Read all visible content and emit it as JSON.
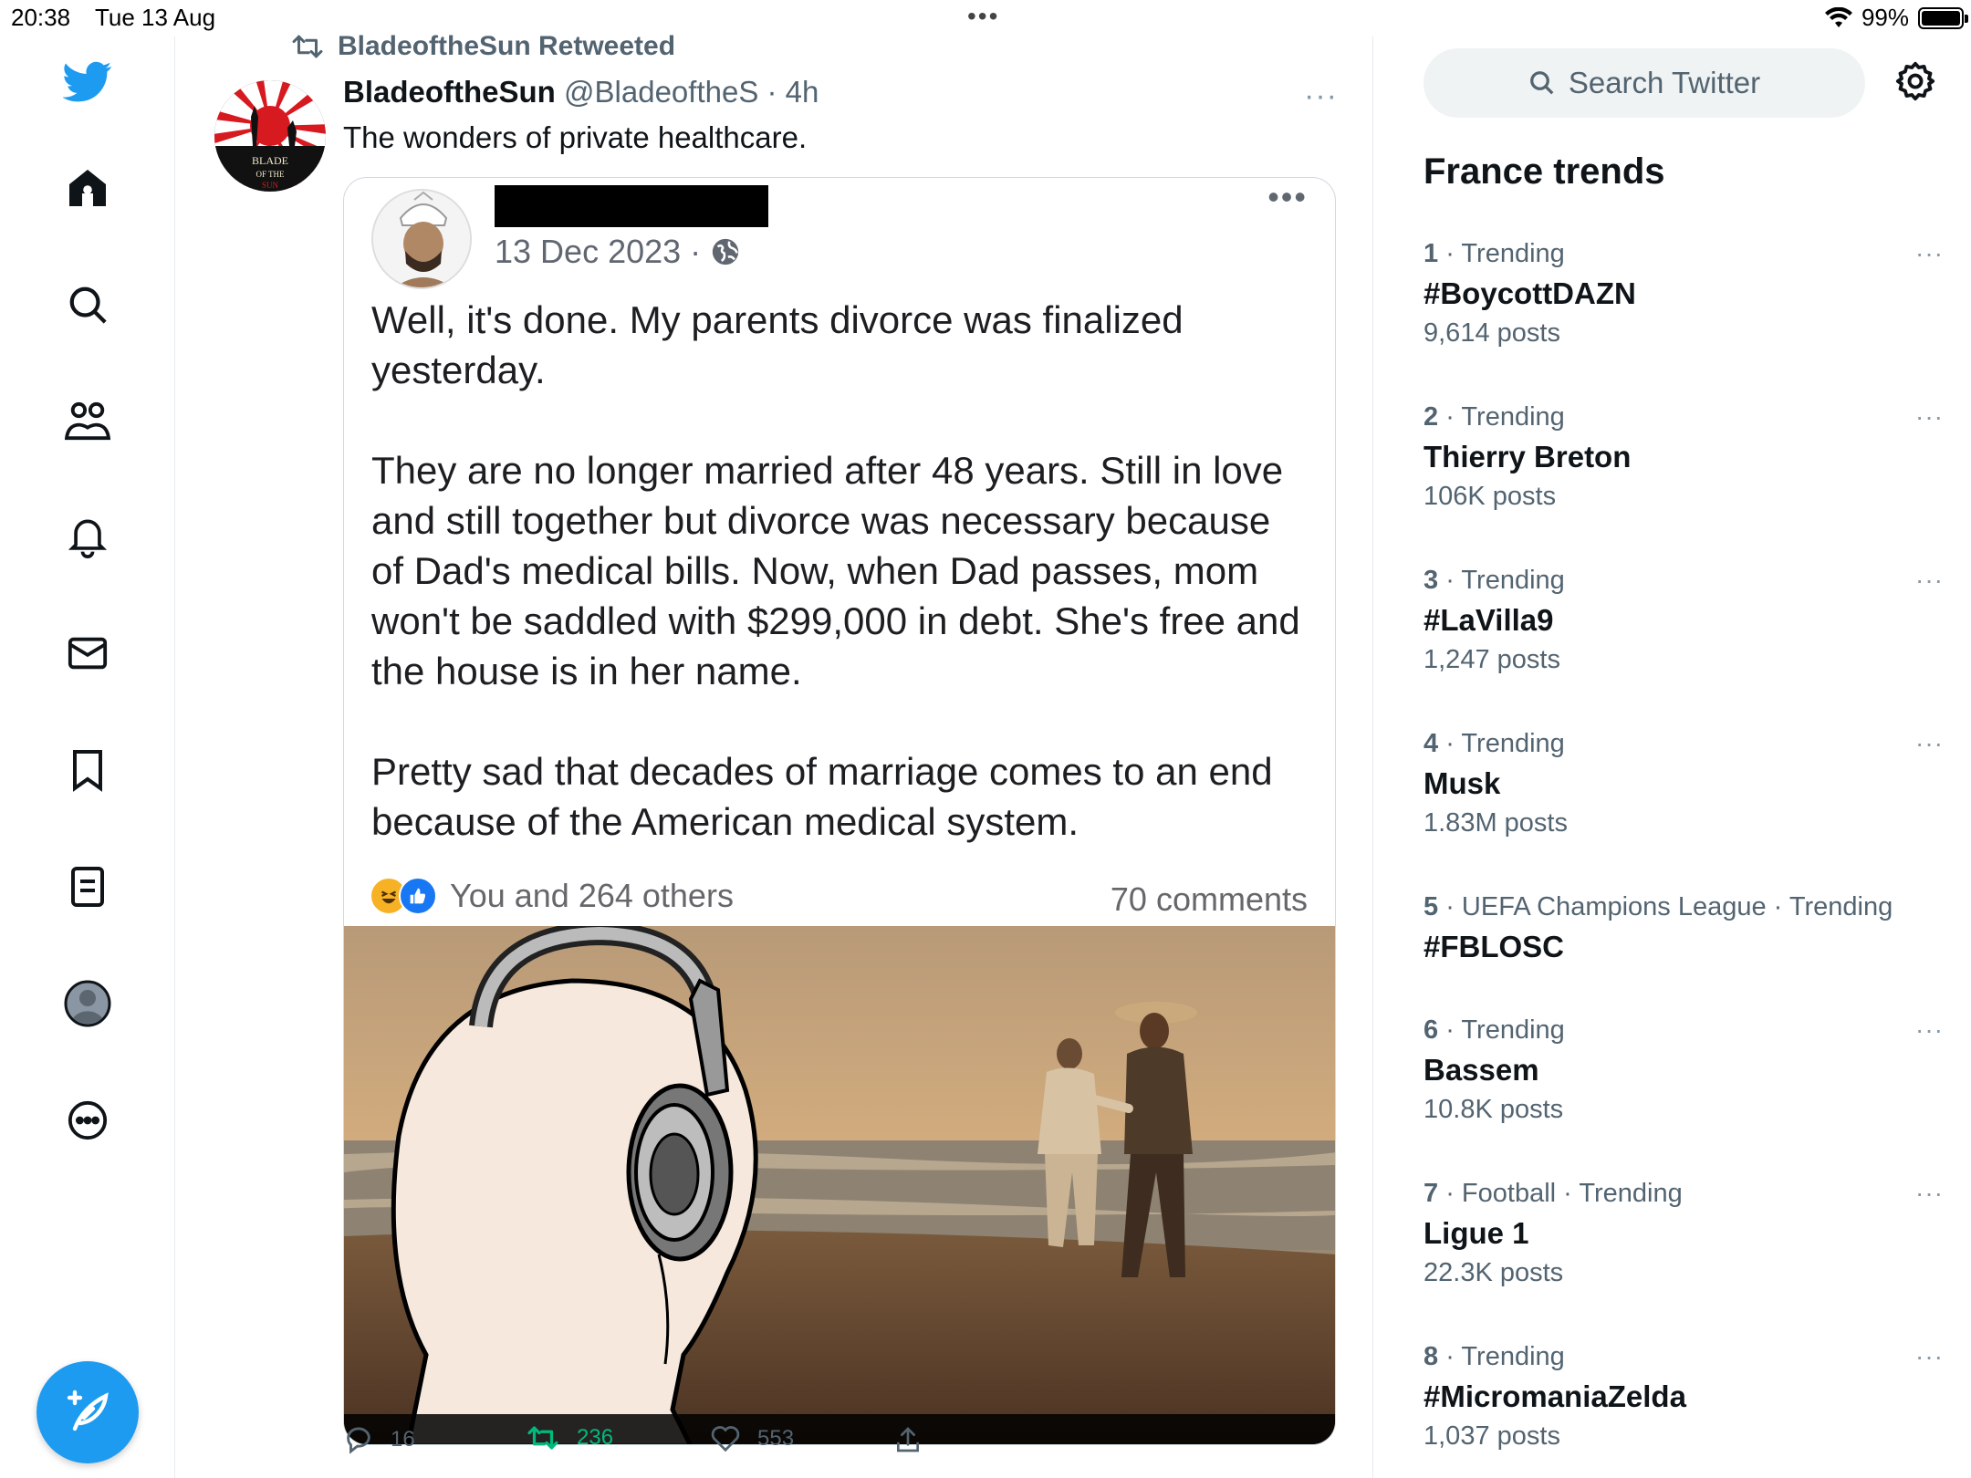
{
  "status_bar": {
    "time": "20:38",
    "date": "Tue 13 Aug",
    "battery": "99%",
    "battery_level": 0.99
  },
  "nav": {
    "items": [
      "twitter-logo",
      "home",
      "explore",
      "communities",
      "notifications",
      "messages",
      "bookmarks",
      "lists",
      "profile",
      "more"
    ]
  },
  "tweet": {
    "retweet_label": "BladeoftheSun Retweeted",
    "author_name": "BladeoftheSun",
    "author_handle": "@BladeoftheS",
    "time": "· 4h",
    "text": "The wonders of private healthcare.",
    "avatar_text": "BLADE OF THE SUN",
    "media": {
      "fb_date": "13 Dec 2023 ·",
      "fb_paragraphs": [
        "Well, it's done. My parents divorce was finalized yesterday.",
        "They are no longer married after 48 years. Still in love and still together but divorce was necessary because of Dad's medical bills. Now, when Dad passes, mom won't be saddled with $299,000 in debt. She's free and the house is in her name.",
        "Pretty sad that decades of marriage comes to an end because of the American medical system."
      ],
      "reactions_text": "You and 264 others",
      "comments_text": "70 comments"
    },
    "actions": {
      "replies": "16",
      "retweets": "236",
      "likes": "553"
    }
  },
  "sidebar": {
    "search_placeholder": "Search Twitter",
    "trends_title": "France trends",
    "trends": [
      {
        "rank": "1",
        "context": "· Trending",
        "name": "#BoycottDAZN",
        "count": "9,614 posts"
      },
      {
        "rank": "2",
        "context": "· Trending",
        "name": "Thierry Breton",
        "count": "106K posts"
      },
      {
        "rank": "3",
        "context": "· Trending",
        "name": "#LaVilla9",
        "count": "1,247 posts"
      },
      {
        "rank": "4",
        "context": "· Trending",
        "name": "Musk",
        "count": "1.83M posts"
      },
      {
        "rank": "5",
        "context": "· UEFA Champions League · Trending",
        "name": "#FBLOSC",
        "count": ""
      },
      {
        "rank": "6",
        "context": "· Trending",
        "name": "Bassem",
        "count": "10.8K posts"
      },
      {
        "rank": "7",
        "context": "· Football · Trending",
        "name": "Ligue 1",
        "count": "22.3K posts"
      },
      {
        "rank": "8",
        "context": "· Trending",
        "name": "#MicromaniaZelda",
        "count": "1,037 posts"
      }
    ]
  },
  "colors": {
    "brand": "#1d9bf0",
    "retweet_green": "#00ba7c",
    "text": "#0f1419",
    "muted": "#536471"
  }
}
